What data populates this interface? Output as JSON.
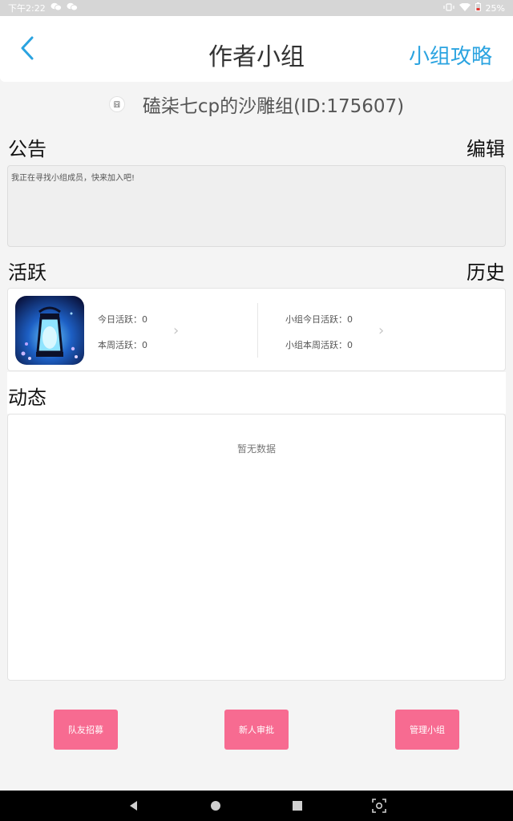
{
  "status": {
    "time": "下午2:22",
    "battery": "25%"
  },
  "header": {
    "title": "作者小组",
    "guide_label": "小组攻略"
  },
  "group": {
    "avatar_text": "囧",
    "name": "磕柒七cp的沙雕组(ID:175607)"
  },
  "notice": {
    "heading": "公告",
    "edit_label": "编辑",
    "text": "我正在寻找小组成员，快来加入吧!"
  },
  "activity": {
    "heading": "活跃",
    "history_label": "历史",
    "today_label": "今日活跃：0",
    "week_label": "本周活跃：0",
    "group_today_label": "小组今日活跃：0",
    "group_week_label": "小组本周活跃：0"
  },
  "feed": {
    "heading": "动态",
    "empty_text": "暂无数据"
  },
  "buttons": {
    "recruit": "队友招募",
    "review": "新人审批",
    "manage": "管理小组"
  },
  "colors": {
    "accent": "#2aa3e0",
    "button": "#f76b91"
  }
}
